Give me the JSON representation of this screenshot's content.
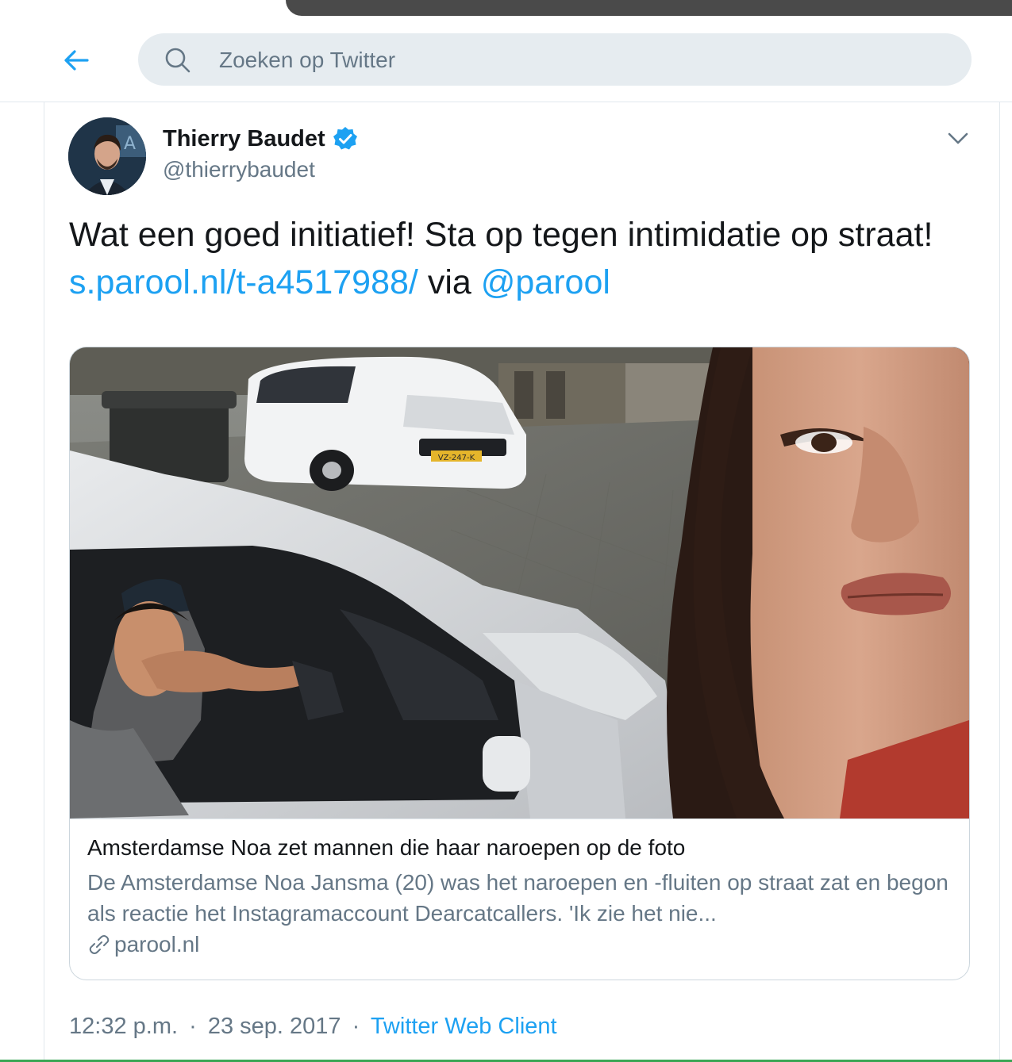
{
  "search": {
    "placeholder": "Zoeken op Twitter"
  },
  "icons": {
    "back": "arrow-left-icon",
    "search": "magnifier-icon",
    "verified": "verified-badge-icon",
    "more": "chevron-down-icon",
    "link": "link-icon"
  },
  "colors": {
    "accent": "#1da1f2",
    "secondary_text": "#657786",
    "search_bg": "#e6ecf0"
  },
  "tweet": {
    "author": {
      "display_name": "Thierry Baudet",
      "handle": "@thierrybaudet"
    },
    "text_part1": "Wat een goed initiatief! Sta op tegen intimidatie op straat! ",
    "link": "s.parool.nl/t-a4517988/",
    "text_part2": " via ",
    "mention": "@parool",
    "time": "12:32 p.m.",
    "separator": "·",
    "date": "23 sep. 2017",
    "source": "Twitter Web Client"
  },
  "card": {
    "title": "Amsterdamse Noa zet mannen die haar naroepen op de foto",
    "description": "De Amsterdamse Noa Jansma (20) was het naroepen en -fluiten op straat zat en begon als reactie het Instagramaccount Dearcatcallers. 'Ik zie het nie...",
    "domain": "parool.nl",
    "plate_text": "VZ-247-K"
  }
}
